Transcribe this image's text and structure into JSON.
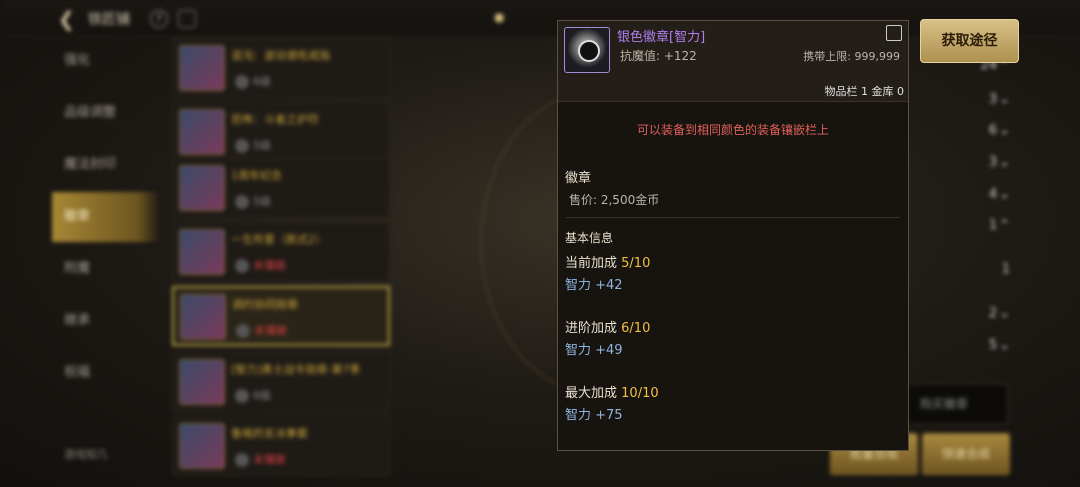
{
  "header": {
    "title": "铁匠铺",
    "help": "?"
  },
  "sidebar": {
    "items": [
      {
        "label": "强化"
      },
      {
        "label": "品级调整"
      },
      {
        "label": "魔法封印"
      },
      {
        "label": "徽章"
      },
      {
        "label": "附魔"
      },
      {
        "label": "继承"
      },
      {
        "label": "祝福"
      }
    ],
    "help_footer": "游戏知几"
  },
  "item_list": [
    {
      "name": "混沌：波动谱吼戒指",
      "sub": "6级"
    },
    {
      "name": "恐怖：斗者之护符",
      "sub": "5级"
    },
    {
      "name": "1周年纪念",
      "sub": "5级"
    },
    {
      "name": "一生所爱（款式2）",
      "sub": "未镶嵌"
    },
    {
      "name": "调约协同勋章",
      "sub": "未镶嵌"
    },
    {
      "name": "[智力]勇士战令勋章-第7季",
      "sub": "6级"
    },
    {
      "name": "鲁格的玄冰拳套",
      "sub": "未镶嵌"
    }
  ],
  "tooltip": {
    "name": "银色徽章[智力]",
    "magic_resist": "抗魔值: +122",
    "carry_limit": "携带上限: 999,999",
    "stock": "物品栏 1 金库 0",
    "warning": "可以装备到相同颜色的装备镶嵌栏上",
    "category": "徽章",
    "price": "售价: 2,500金币",
    "basic_info": "基本信息",
    "current_label": "当前加成",
    "current_value": "5/10",
    "current_stat": "智力 +42",
    "advanced_label": "进阶加成",
    "advanced_value": "6/10",
    "advanced_stat": "智力 +49",
    "max_label": "最大加成",
    "max_value": "10/10",
    "max_stat": "智力 +75"
  },
  "actions": {
    "get_path": "获取途径",
    "buy_badge": "购买徽章",
    "quick_synth": "快速合成",
    "batch_synth": "批量合成"
  },
  "right_counts": [
    "24",
    "3",
    "6",
    "3",
    "4",
    "1",
    "1",
    "2",
    "5"
  ]
}
